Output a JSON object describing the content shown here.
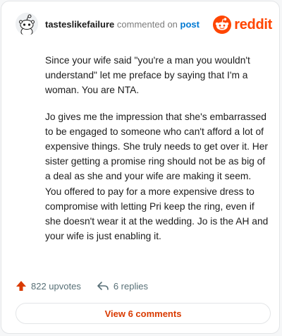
{
  "comment": {
    "username": "tasteslikefailure",
    "action": "commented on",
    "post_link": "post",
    "paragraphs": [
      "Since your wife said \"you're a man you wouldn't understand\" let me preface by saying that I'm a woman. You are NTA.",
      "Jo gives me the impression that she's embarrassed to be engaged to someone who can't afford a lot of expensive things. She truly needs to get over it. Her sister getting a promise ring should not be as big of a deal as she and your wife are making it seem. You offered to pay for a more expensive dress to compromise with letting Pri keep the ring, even if she doesn't wear it at the wedding. Jo is the AH and your wife is just enabling it."
    ]
  },
  "brand": {
    "wordmark": "reddit",
    "color": "#ff4500"
  },
  "stats": {
    "upvotes": "822 upvotes",
    "replies": "6 replies"
  },
  "view_button": {
    "label": "View 6 comments"
  },
  "icons": {
    "avatar": "snoo-avatar-icon",
    "logo": "reddit-logo-icon",
    "upvote": "upvote-arrow-icon",
    "reply": "reply-arrow-icon"
  }
}
